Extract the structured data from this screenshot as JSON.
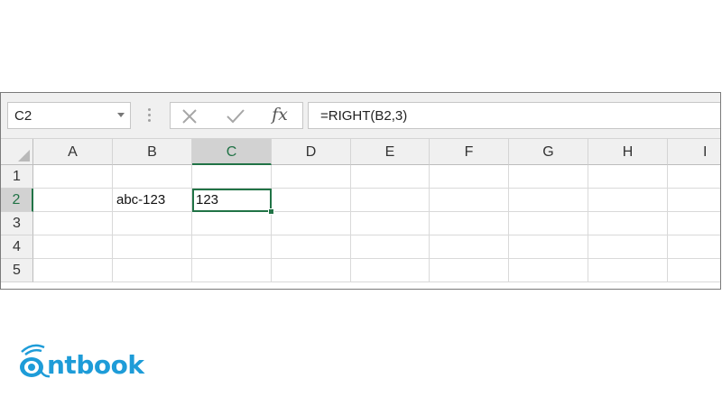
{
  "formula_bar": {
    "name_box": "C2",
    "formula": "=RIGHT(B2,3)",
    "fx_label": "fx"
  },
  "columns": [
    "A",
    "B",
    "C",
    "D",
    "E",
    "F",
    "G",
    "H",
    "I"
  ],
  "rows": [
    "1",
    "2",
    "3",
    "4",
    "5"
  ],
  "cells": {
    "B2": "abc-123",
    "C2": "123"
  },
  "selected_cell": "C2",
  "colors": {
    "accent": "#217346",
    "logo": "#1e9cd8"
  },
  "logo": {
    "text": "ntbook",
    "icon": "owl-eye-logo-icon"
  }
}
